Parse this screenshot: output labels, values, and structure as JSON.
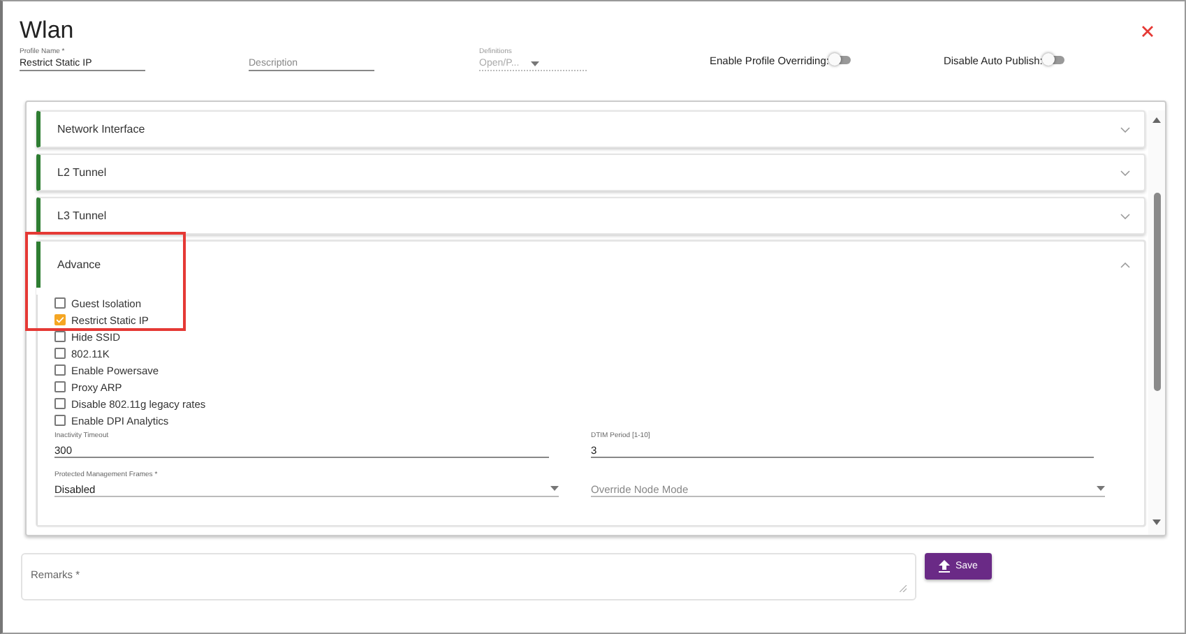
{
  "window": {
    "title": "Wlan"
  },
  "header_fields": [
    {
      "kind": "text",
      "label": "Profile Name *",
      "value": "Restrict Static IP"
    },
    {
      "kind": "text",
      "placeholder": "Description"
    },
    {
      "kind": "select",
      "label": "Definitions",
      "value": "Open/P...",
      "disabled": true
    }
  ],
  "toggles": [
    {
      "label": "Enable Profile Overriding:",
      "on": false
    },
    {
      "label": "Disable Auto Publish:",
      "on": false
    }
  ],
  "sections": [
    {
      "title": "Network Interface",
      "expanded": false
    },
    {
      "title": "L2 Tunnel",
      "expanded": false
    },
    {
      "title": "L3 Tunnel",
      "expanded": false
    },
    {
      "title": "Advance",
      "expanded": true,
      "checkboxes": [
        {
          "label": "Guest Isolation",
          "checked": false
        },
        {
          "label": "Restrict Static IP",
          "checked": true
        },
        {
          "label": "Hide SSID",
          "checked": false
        },
        {
          "label": "802.11K",
          "checked": false
        },
        {
          "label": "Enable Powersave",
          "checked": false
        },
        {
          "label": "Proxy ARP",
          "checked": false
        },
        {
          "label": "Disable 802.11g legacy rates",
          "checked": false
        },
        {
          "label": "Enable DPI Analytics",
          "checked": false
        }
      ],
      "fields": [
        {
          "kind": "text",
          "label": "Inactivity Timeout",
          "value": "300"
        },
        {
          "kind": "text",
          "label": "DTIM Period [1-10]",
          "value": "3"
        },
        {
          "kind": "select",
          "label": "Protected Management Frames *",
          "value": "Disabled"
        },
        {
          "kind": "select",
          "placeholder": "Override Node Mode"
        }
      ]
    }
  ],
  "remarks": {
    "placeholder": "Remarks *"
  },
  "save_button": {
    "label": "Save"
  }
}
